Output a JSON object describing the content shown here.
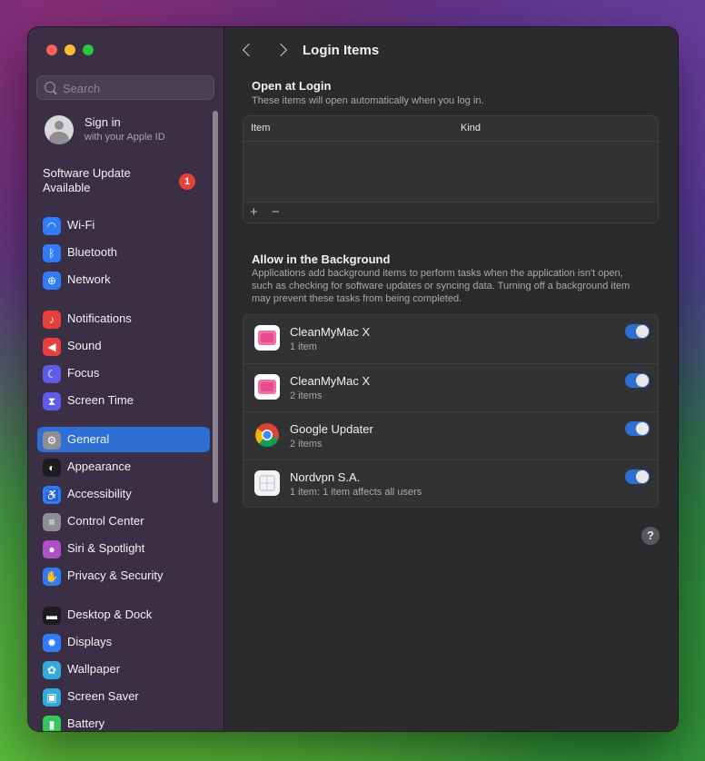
{
  "search": {
    "placeholder": "Search"
  },
  "account": {
    "title": "Sign in",
    "subtitle": "with your Apple ID"
  },
  "update": {
    "label": "Software Update Available",
    "badge": "1"
  },
  "sidebar": {
    "items": [
      {
        "label": "Wi-Fi",
        "icon": "wifi-icon",
        "color": "#2f7cf6"
      },
      {
        "label": "Bluetooth",
        "icon": "bluetooth-icon",
        "color": "#2f7cf6"
      },
      {
        "label": "Network",
        "icon": "globe-icon",
        "color": "#2f7cf6"
      },
      {
        "label": "Notifications",
        "icon": "bell-icon",
        "color": "#e5403a"
      },
      {
        "label": "Sound",
        "icon": "speaker-icon",
        "color": "#e5403a"
      },
      {
        "label": "Focus",
        "icon": "moon-icon",
        "color": "#5e5ce6"
      },
      {
        "label": "Screen Time",
        "icon": "hourglass-icon",
        "color": "#5e5ce6"
      },
      {
        "label": "General",
        "icon": "gear-icon",
        "color": "#8e8e93"
      },
      {
        "label": "Appearance",
        "icon": "appearance-icon",
        "color": "#1c1c1e"
      },
      {
        "label": "Accessibility",
        "icon": "accessibility-icon",
        "color": "#2f7cf6"
      },
      {
        "label": "Control Center",
        "icon": "control-center-icon",
        "color": "#8e8e93"
      },
      {
        "label": "Siri & Spotlight",
        "icon": "siri-icon",
        "color": "#b14fc9"
      },
      {
        "label": "Privacy & Security",
        "icon": "hand-icon",
        "color": "#2f7cf6"
      },
      {
        "label": "Desktop & Dock",
        "icon": "dock-icon",
        "color": "#1c1c1e"
      },
      {
        "label": "Displays",
        "icon": "sun-icon",
        "color": "#2f7cf6"
      },
      {
        "label": "Wallpaper",
        "icon": "flower-icon",
        "color": "#34aadc"
      },
      {
        "label": "Screen Saver",
        "icon": "screensaver-icon",
        "color": "#34aadc"
      },
      {
        "label": "Battery",
        "icon": "battery-icon",
        "color": "#34c759"
      }
    ],
    "active": "General"
  },
  "main": {
    "title": "Login Items",
    "open_at_login": {
      "heading": "Open at Login",
      "description": "These items will open automatically when you log in.",
      "columns": [
        "Item",
        "Kind"
      ],
      "add_label": "+",
      "remove_label": "−"
    },
    "background": {
      "heading": "Allow in the Background",
      "description": "Applications add background items to perform tasks when the application isn't open, such as checking for software updates or syncing data. Turning off a background item may prevent these tasks from being completed.",
      "items": [
        {
          "name": "CleanMyMac X",
          "detail": "1 item",
          "enabled": true,
          "icon": "cleanmymac-icon"
        },
        {
          "name": "CleanMyMac X",
          "detail": "2 items",
          "enabled": true,
          "icon": "cleanmymac-icon"
        },
        {
          "name": "Google Updater",
          "detail": "2 items",
          "enabled": true,
          "icon": "chrome-icon"
        },
        {
          "name": "Nordvpn S.A.",
          "detail": "1 item: 1 item affects all users",
          "enabled": true,
          "icon": "nordvpn-icon"
        }
      ]
    },
    "help_label": "?"
  }
}
